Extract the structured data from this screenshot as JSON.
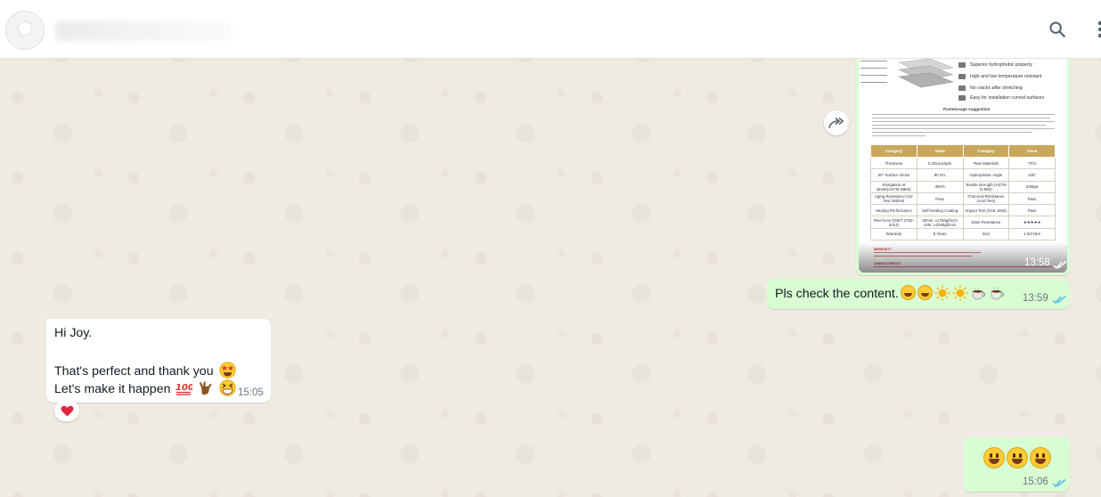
{
  "header": {
    "search_icon": "search-icon",
    "menu_icon": "kebab-menu-icon"
  },
  "image_message": {
    "time": "13:58",
    "status": "read",
    "document": {
      "features": [
        "Superior hydrophobic property",
        "High and low temperature resistant",
        "No cracks after stretching",
        "Easy for installation curved surfaces"
      ],
      "section_heading": "Paste/usage suggestion",
      "table": {
        "headers": [
          "Category",
          "Value",
          "Category",
          "Value"
        ],
        "rows": [
          [
            "Thickness",
            "0.2mm±10μm",
            "Raw Materials",
            "TPU"
          ],
          [
            "60° Surface Gloss",
            "90 GU",
            "Hydrophobic Angle",
            "105°"
          ],
          [
            "Elongation at Break(ASTM D882)",
            "350%",
            "Tensile strength (ASTM D-882)",
            "32Mpa"
          ],
          [
            "Aging Resistance (UV Test 2000H)",
            "Pass",
            "Chemical Resistance (Acid Test)",
            "Pass"
          ],
          [
            "Healing Performance",
            "Self-Healing Coating",
            "Impact Test (SAE J400)",
            "Pass"
          ],
          [
            "Peel force (GB/T 2792-2014)",
            "20min: ≥1750gf/inch 24hr: ≥2250gf/inch",
            "Stain Resistance",
            "★★★★★"
          ],
          [
            "Warranty",
            "8 Years",
            "Size",
            "1.52*15m"
          ]
        ]
      },
      "warning_label": "WARRANTY",
      "characteristic_label": "CHARACTERISTIC"
    }
  },
  "text_message_1": {
    "text": "Pls check the content.",
    "emojis": [
      "smiley",
      "smiley",
      "sun",
      "sun",
      "coffee",
      "coffee"
    ],
    "time": "13:59",
    "status": "read"
  },
  "incoming_message": {
    "line1": "Hi Joy.",
    "line2": "That's perfect and thank you",
    "line3": "Let's make it happen",
    "emojis_line2": [
      "star-struck"
    ],
    "emojis_line3": [
      "hundred-points",
      "call-me-hand",
      "grinning-squinting"
    ],
    "time": "15:05",
    "reaction": "❤️"
  },
  "emoji_message": {
    "emojis": [
      "smiley",
      "smiley",
      "smiley"
    ],
    "time": "15:06",
    "status": "read"
  },
  "colors": {
    "chat_bg": "#efeae2",
    "outgoing_bubble": "#d9fdd3",
    "incoming_bubble": "#ffffff",
    "read_ticks": "#53bdeb",
    "timestamp": "#667781"
  }
}
